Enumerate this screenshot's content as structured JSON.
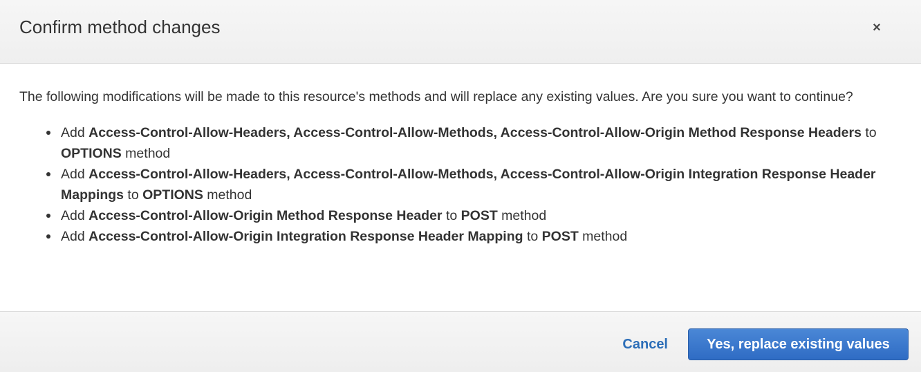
{
  "dialog": {
    "title": "Confirm method changes",
    "close_icon": "close-icon",
    "close_glyph": "×"
  },
  "body": {
    "intro": "The following modifications will be made to this resource's methods and will replace any existing values. Are you sure you want to continue?",
    "changes": [
      {
        "prefix": "Add ",
        "subject": "Access-Control-Allow-Headers, Access-Control-Allow-Methods, Access-Control-Allow-Origin Method Response Headers",
        "connector": " to ",
        "method": "OPTIONS",
        "suffix": " method"
      },
      {
        "prefix": "Add ",
        "subject": "Access-Control-Allow-Headers, Access-Control-Allow-Methods, Access-Control-Allow-Origin Integration Response Header Mappings",
        "connector": " to ",
        "method": "OPTIONS",
        "suffix": " method"
      },
      {
        "prefix": "Add ",
        "subject": "Access-Control-Allow-Origin Method Response Header",
        "connector": " to ",
        "method": "POST",
        "suffix": " method"
      },
      {
        "prefix": "Add ",
        "subject": "Access-Control-Allow-Origin Integration Response Header Mapping",
        "connector": " to ",
        "method": "POST",
        "suffix": " method"
      }
    ]
  },
  "footer": {
    "cancel_label": "Cancel",
    "confirm_label": "Yes, replace existing values"
  },
  "colors": {
    "primary_button": "#3a7bd0",
    "link": "#2c6eb8",
    "text": "#333333"
  }
}
